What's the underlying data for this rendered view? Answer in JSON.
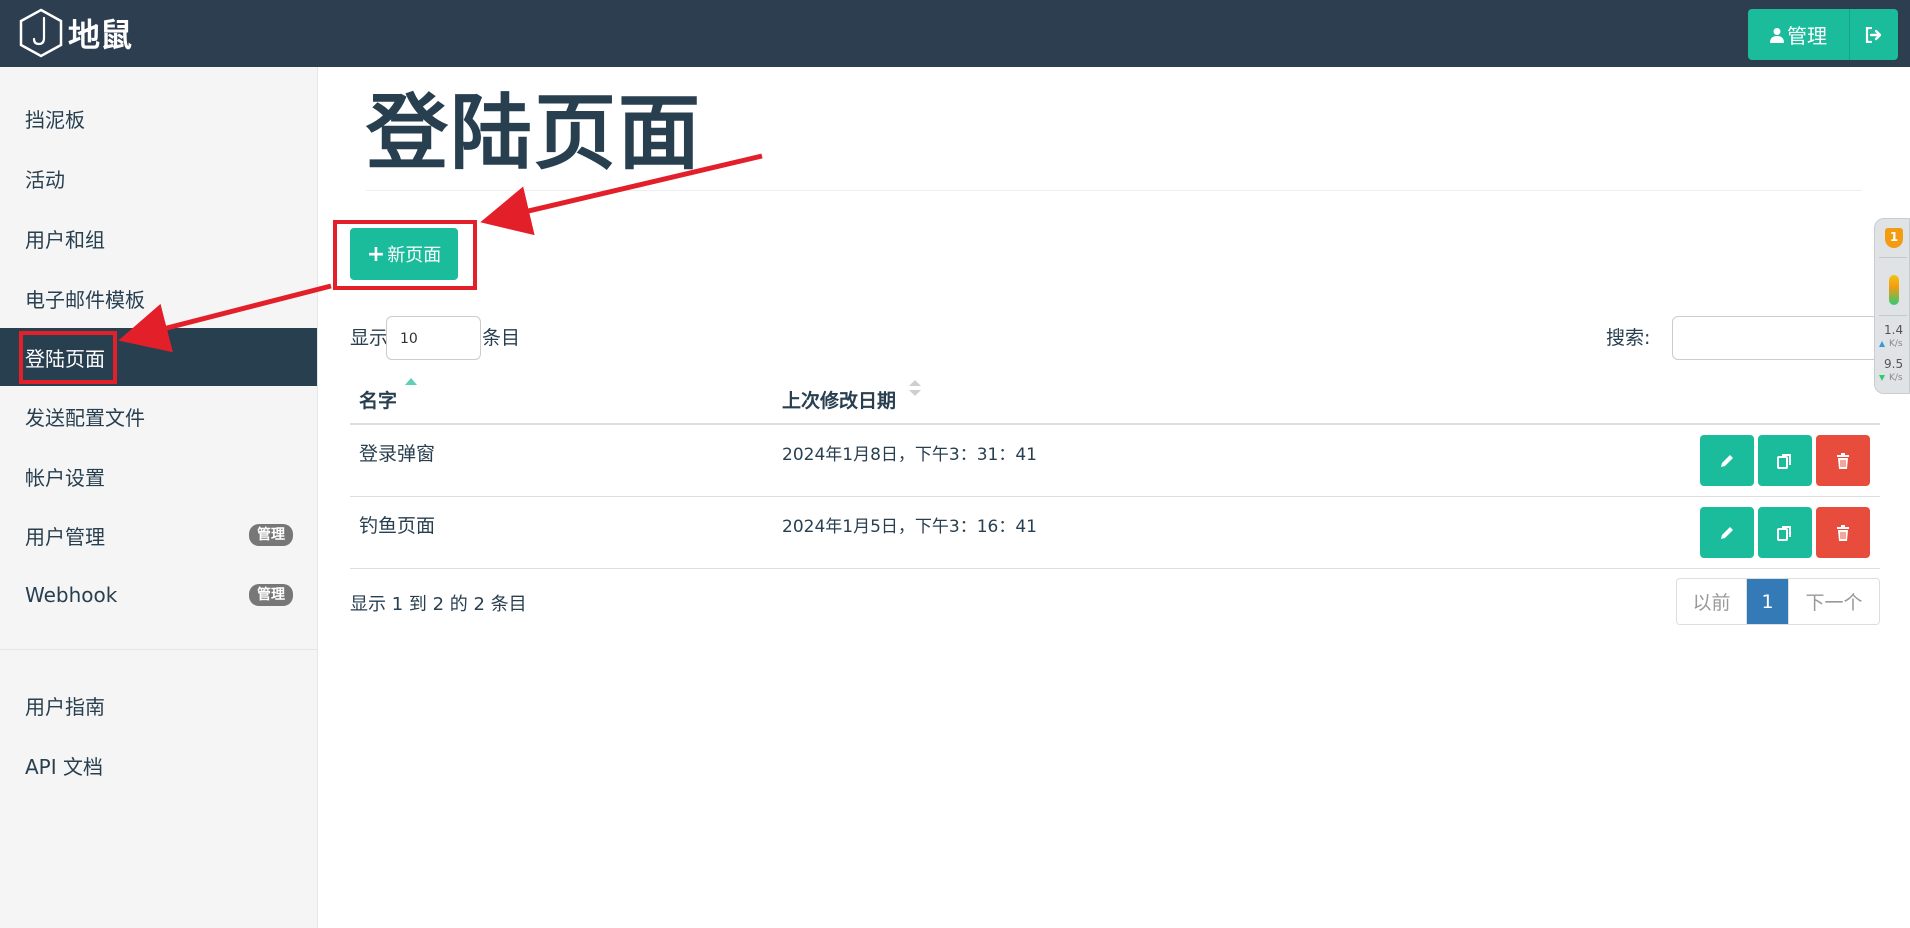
{
  "brand": {
    "name": "地鼠"
  },
  "header": {
    "admin_label": "管理"
  },
  "sidebar": {
    "items": [
      {
        "label": "挡泥板"
      },
      {
        "label": "活动"
      },
      {
        "label": "用户和组"
      },
      {
        "label": "电子邮件模板"
      },
      {
        "label": "登陆页面",
        "active": true
      },
      {
        "label": "发送配置文件"
      },
      {
        "label": "帐户设置"
      },
      {
        "label": "用户管理",
        "badge": "管理"
      },
      {
        "label": "Webhook",
        "badge": "管理"
      }
    ],
    "bottom_items": [
      {
        "label": "用户指南"
      },
      {
        "label": "API 文档"
      }
    ]
  },
  "main": {
    "title": "登陆页面",
    "new_button_label": "新页面",
    "length": {
      "prefix": "显示",
      "value": "10",
      "suffix": "条目"
    },
    "search_label": "搜索:",
    "table": {
      "headers": [
        "名字",
        "上次修改日期"
      ],
      "rows": [
        {
          "name": "登录弹窗",
          "date": "2024年1月8日，下午3：31：41"
        },
        {
          "name": "钓鱼页面",
          "date": "2024年1月5日，下午3：16：41"
        }
      ]
    },
    "info": "显示 1 到 2 的 2 条目",
    "pagination": {
      "prev": "以前",
      "current": "1",
      "next": "下一个"
    }
  },
  "widget": {
    "badge": "1",
    "up_value": "1.4",
    "up_unit": "K/s",
    "down_value": "9.5",
    "down_unit": "K/s"
  },
  "colors": {
    "header_bg": "#2c3e50",
    "accent": "#1abc9c",
    "danger": "#e74c3c",
    "active_nav": "#283f50",
    "page_active": "#337ab7",
    "annotation": "#e3202a"
  }
}
